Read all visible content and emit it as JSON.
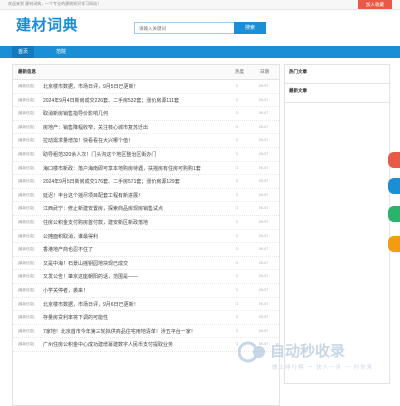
{
  "topbar": {
    "welcome": "欢迎来到 建材词典，一个专业的建筑知识学习网站！",
    "join": "加入收藏"
  },
  "header": {
    "logo": "建材词典",
    "search_placeholder": "请输入关键词",
    "search_button": "搜索"
  },
  "nav": {
    "tabs": [
      "首页",
      "范院"
    ]
  },
  "main": {
    "heading": "最新信息",
    "col_count": "热度",
    "col_date": "日期",
    "rows": [
      {
        "tag": "[最新信息]",
        "title": "北京楼市数据，市场日评，9月5日已更新！",
        "num": "3",
        "date": "09-07"
      },
      {
        "tag": "[最新信息]",
        "title": "2024年9月4日新房成交226套、二手房532套；涨价房源111套",
        "num": "3",
        "date": "09-07"
      },
      {
        "tag": "[最新信息]",
        "title": "取消新房销售指导价影响几何",
        "num": "3",
        "date": "09-07"
      },
      {
        "tag": "[最新信息]",
        "title": "房地产：销售降幅收窄，关注核心城市复苏迁出",
        "num": "3",
        "date": "09-07"
      },
      {
        "tag": "[最新信息]",
        "title": "拉动需求量增加！快看看在大兴哪个值！",
        "num": "3",
        "date": "09-07"
      },
      {
        "tag": "[最新信息]",
        "title": "助导租范320余人次！门头沟这个地区整治区街办门",
        "num": "3",
        "date": "09-07"
      },
      {
        "tag": "[最新信息]",
        "title": "海口楼市新政：落户海南即可享本地购房待遇，扶摇房有住房可购购1套",
        "num": "3",
        "date": "09-07"
      },
      {
        "tag": "[最新信息]",
        "title": "2024年9月5日新房成交176套、二手房571套；涨价房源129套",
        "num": "3",
        "date": "09-07"
      },
      {
        "tag": "[最新信息]",
        "title": "延迟！丰台这个摇尽项目配套工程有新进展！",
        "num": "3",
        "date": "09-07"
      },
      {
        "tag": "[最新信息]",
        "title": "江西武宁：修止新建安置房，探索商品房现房销售试点",
        "num": "3",
        "date": "09-07"
      },
      {
        "tag": "[最新信息]",
        "title": "住房公积金支付购房首付款，建安新区新政落地",
        "num": "3",
        "date": "09-07"
      },
      {
        "tag": "[最新信息]",
        "title": "公摊面积取消，谁最得利",
        "num": "3",
        "date": "09-07"
      },
      {
        "tag": "[最新信息]",
        "title": "香港地产商也忍不住了",
        "num": "3",
        "date": "09-07"
      },
      {
        "tag": "[最新信息]",
        "title": "又是中海！石景山摇钥园地块现已成交",
        "num": "3",
        "date": "09-07"
      },
      {
        "tag": "[最新信息]",
        "title": "又发公告！肇京这座朝阳的话，范围是——",
        "num": "3",
        "date": "09-07"
      },
      {
        "tag": "[最新信息]",
        "title": "小学关停者，袭来！",
        "num": "3",
        "date": "09-07"
      },
      {
        "tag": "[最新信息]",
        "title": "北京楼市数据，市场日评，9月6日已更新！",
        "num": "3",
        "date": "09-07"
      },
      {
        "tag": "[最新信息]",
        "title": "存量房贷利率将下调的可能性",
        "num": "3",
        "date": "09-07"
      },
      {
        "tag": "[最新信息]",
        "title": "7家地！北京首市今年第三轮拟供商品住宅用地清单！涉五平台一家！",
        "num": "3",
        "date": "09-07"
      },
      {
        "tag": "[最新信息]",
        "title": "广州住房公积金中心成功建增幂建数字人民币支付提取业务",
        "num": "3",
        "date": "09-07"
      }
    ]
  },
  "side": {
    "hot": "热门文章",
    "latest": "最新文章"
  },
  "watermark": {
    "big": "自动秒收录",
    "small": "做上排行榜 一 快人一步 一 约你来"
  },
  "colors": {
    "accent": "#1a8fd6",
    "join": "#e85a47"
  }
}
